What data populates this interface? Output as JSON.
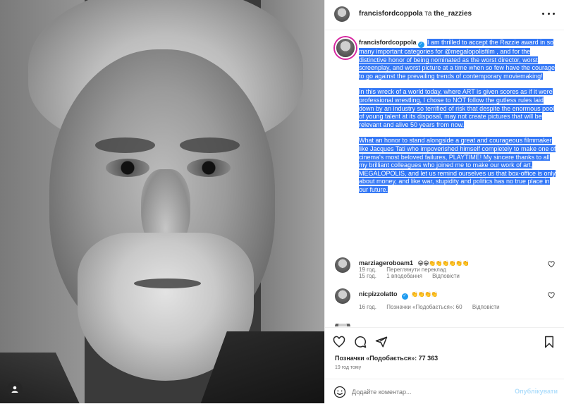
{
  "post": {
    "authors": {
      "primary": "francisfordcoppola",
      "joiner": "та",
      "secondary": "the_razzies"
    },
    "caption": {
      "username": "francisfordcoppola",
      "paragraphs": [
        "I am thrilled to accept the Razzie award in so many important categories for @megalopolisfilm , and for the distinctive honor of being nominated as the worst director, worst screenplay, and worst picture at a time when so few have the courage to go against the prevailing trends of contemporary moviemaking!",
        "In this wreck of a world today, where ART is given scores as if it were professional wrestling, I chose to NOT follow the gutless rules laid down by an industry so terrified of risk that despite the enormous pool of young talent at its disposal, may not create pictures that will be relevant and alive 50 years from now.",
        "What an honor to stand alongside a great and courageous filmmaker like Jacques Tati who impoverished himself completely to make one of cinema's most beloved failures, PLAYTIME! My sincere thanks to all my brilliant colleagues who joined me to make our work of art, MEGALOPOLIS, and let us remind ourselves us that box-office is only about money, and like war, stupidity and politics has no true place in our future."
      ],
      "age": "19 год.",
      "translate_label": "Переглянути переклад"
    },
    "comments": [
      {
        "username": "marziageroboam1",
        "text": "😁😁👏👏👏👏👏👏",
        "age": "15 год.",
        "likes": "1 вподобання",
        "reply_label": "Відповісти"
      },
      {
        "username": "nicpizzolatto",
        "text": "👏👏👏👏",
        "age": "16 год.",
        "likes": "Позначки «Подобається»: 60",
        "reply_label": "Відповісти"
      }
    ],
    "likes_label": "Позначки «Подобається»: 77 363",
    "timestamp": "19 год тому",
    "comment_input": {
      "placeholder": "Додайте коментар..."
    },
    "post_button": "Опублікувати",
    "colors": {
      "selection": "#3478f6",
      "verified": "#1d9bf0",
      "like_red": "#ed4956",
      "post_disabled": "#b2dffc",
      "muted": "#737373"
    }
  }
}
